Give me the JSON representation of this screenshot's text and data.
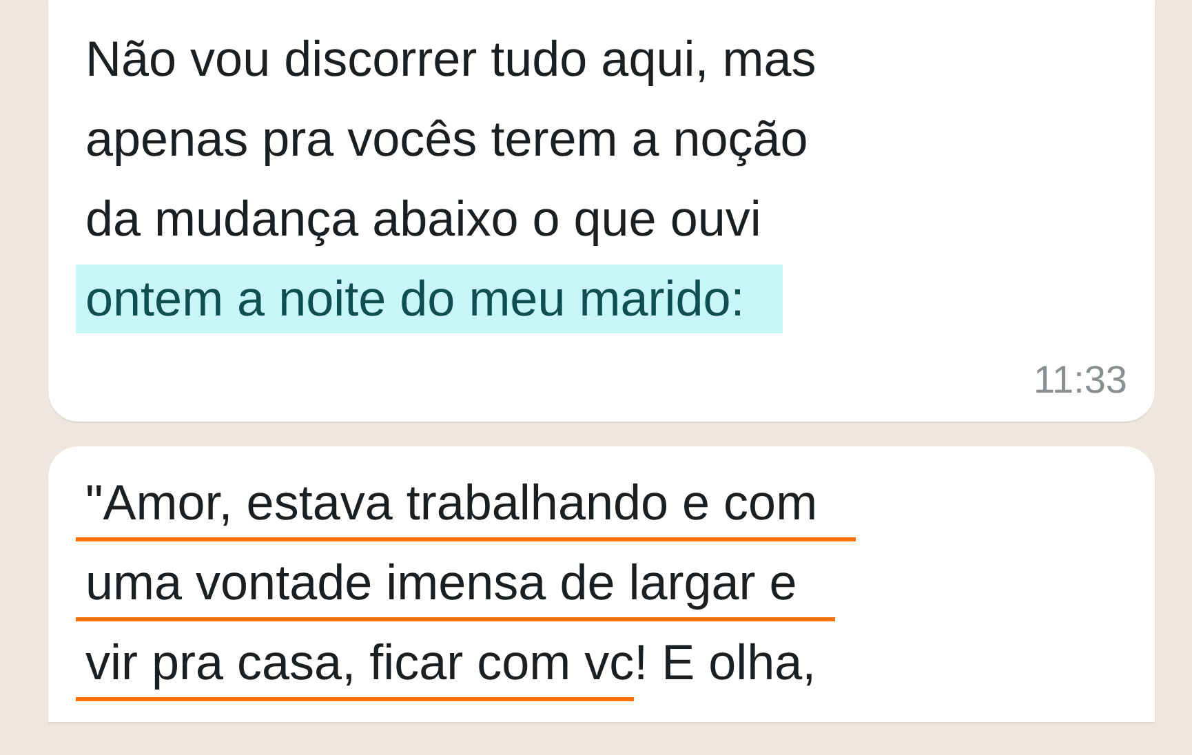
{
  "messages": [
    {
      "lines": [
        [
          {
            "text": "Não vou discorrer tudo aqui, mas",
            "highlighted": false
          }
        ],
        [
          {
            "text": "apenas pra vocês terem a noção",
            "highlighted": false
          }
        ],
        [
          {
            "text": "da mudança abaixo o que ouvi",
            "highlighted": false
          }
        ],
        [
          {
            "text": "ontem a noite do meu marido:",
            "highlighted": true
          }
        ]
      ],
      "time": "11:33"
    },
    {
      "lines": [
        [
          {
            "text": "\"Amor, estava trabalhando e com",
            "underlined": true
          }
        ],
        [
          {
            "text": "uma vontade imensa de largar e",
            "underlined": true
          }
        ],
        [
          {
            "text": "vir pra casa, ficar com vc",
            "underlined": true
          },
          {
            "text": "! E olha,",
            "underlined": false
          }
        ]
      ]
    }
  ]
}
